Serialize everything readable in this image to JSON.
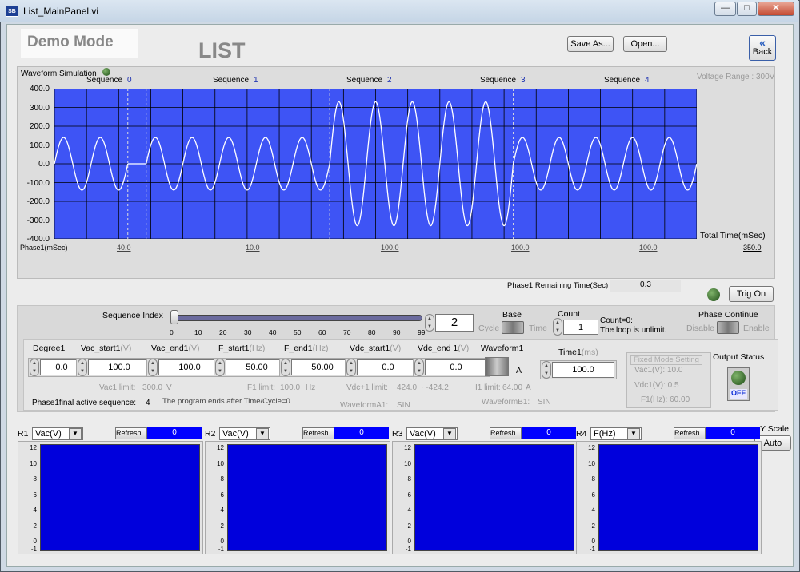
{
  "window": {
    "title": "List_MainPanel.vi",
    "icon_text": "SB",
    "minimize": "—",
    "maximize": "□",
    "close": "✕"
  },
  "header": {
    "demo_mode": "Demo Mode",
    "list_title": "LIST",
    "save_as": "Save As...",
    "open": "Open...",
    "back": "Back"
  },
  "chart": {
    "waveform_simulation": "Waveform Simulation",
    "voltage_range": "Voltage Range : 300V",
    "sequence_label": "Sequence",
    "sequences": [
      "0",
      "1",
      "2",
      "3",
      "4"
    ],
    "y_ticks": [
      "400.0",
      "300.0",
      "200.0",
      "100.0",
      "0.0",
      "-100.0",
      "-200.0",
      "-300.0",
      "-400.0"
    ],
    "total_time": "Total Time(mSec)",
    "phase1_label": "Phase1(mSec)",
    "phase_values": [
      "40.0",
      "10.0",
      "100.0",
      "100.0",
      "100.0"
    ],
    "total_value": "350.0"
  },
  "chart_data": {
    "type": "line",
    "title": "",
    "xlabel": "Total Time(mSec)",
    "ylabel": "",
    "ylim": [
      -400,
      400
    ],
    "x_range": [
      0,
      350
    ],
    "grid": true,
    "segments": [
      {
        "sequence": "0",
        "duration_ms": 40,
        "amplitude": 140,
        "freq_hz": 50
      },
      {
        "sequence": "1",
        "duration_ms": 10,
        "amplitude": 0,
        "freq_hz": 0
      },
      {
        "sequence": "2",
        "duration_ms": 100,
        "amplitude": 140,
        "freq_hz": 50
      },
      {
        "sequence": "3",
        "duration_ms": 100,
        "amplitude": 330,
        "freq_hz": 50
      },
      {
        "sequence": "4",
        "duration_ms": 100,
        "amplitude": 140,
        "freq_hz": 50
      }
    ]
  },
  "status": {
    "remaining_label": "Phase1 Remaining Time(Sec)",
    "remaining_value": "0.3",
    "trig_on": "Trig On"
  },
  "sequence": {
    "index_label": "Sequence Index",
    "ticks": [
      "0",
      "10",
      "20",
      "30",
      "40",
      "50",
      "60",
      "70",
      "80",
      "90",
      "99"
    ],
    "index_value": "2",
    "base_label": "Base",
    "cycle": "Cycle",
    "time": "Time",
    "count_label": "Count",
    "count_value": "1",
    "count_note1": "Count=0:",
    "count_note2": "The loop is unlimit.",
    "phase_continue": "Phase Continue",
    "disable": "Disable",
    "enable": "Enable"
  },
  "params": {
    "headers": [
      {
        "name": "Degree1",
        "unit": ""
      },
      {
        "name": "Vac_start1",
        "unit": "(V)"
      },
      {
        "name": "Vac_end1",
        "unit": "(V)"
      },
      {
        "name": "F_start1",
        "unit": "(Hz)"
      },
      {
        "name": "F_end1",
        "unit": "(Hz)"
      },
      {
        "name": "Vdc_start1",
        "unit": "(V)"
      },
      {
        "name": "Vdc_end 1",
        "unit": "(V)"
      },
      {
        "name": "Waveform1",
        "unit": ""
      }
    ],
    "values": [
      "0.0",
      "100.0",
      "100.0",
      "50.00",
      "50.00",
      "0.0",
      "0.0"
    ],
    "waveform_value": "A",
    "time1_label": "Time1",
    "time1_unit": "(ms)",
    "time1_value": "100.0",
    "vac1_limit": "Vac1 limit:",
    "vac1_limit_value": "300.0",
    "vac1_limit_unit": "V",
    "f1_limit": "F1 limit:",
    "f1_limit_value": "100.0",
    "f1_limit_unit": "Hz",
    "vdc1_limit": "Vdc+1 limit:",
    "vdc1_limit_value": "424.0 ~  -424.2",
    "i1_limit": "I1 limit:",
    "i1_limit_value": "64.00",
    "i1_limit_unit": "A",
    "final_seq_label": "Phase1final active sequence:",
    "final_seq_value": "4",
    "program_ends": "The program ends after Time/Cycle=0",
    "waveformA1": "WaveformA1:",
    "waveformA1_value": "SIN",
    "waveformB1": "WaveformB1:",
    "waveformB1_value": "SIN",
    "fixed_title": "Fixed Mode Setting",
    "fixed_vac": "Vac1(V): 10.0",
    "fixed_vdc": "Vdc1(V): 0.5",
    "fixed_f": "F1(Hz): 60.00",
    "output_status": "Output Status",
    "off": "OFF"
  },
  "meters": {
    "y_scale": "Y Scale",
    "auto": "Auto",
    "refresh": "Refresh",
    "items": [
      {
        "label": "R1",
        "select": "Vac(V)",
        "value": "0"
      },
      {
        "label": "R2",
        "select": "Vac(V)",
        "value": "0"
      },
      {
        "label": "R3",
        "select": "Vac(V)",
        "value": "0"
      },
      {
        "label": "R4",
        "select": "F(Hz)",
        "value": "0"
      }
    ],
    "ticks": [
      "12",
      "10",
      "8",
      "6",
      "4",
      "2",
      "0",
      "-1"
    ],
    "ticks_r4": [
      "12",
      "10",
      "8",
      "6",
      "4",
      "2",
      "0",
      "-1"
    ]
  },
  "colors": {
    "plot_bg": "#3e54f5",
    "meter_bg": "#0000dc",
    "value_bg": "#0000ff",
    "led_green": "#2f6b22"
  }
}
